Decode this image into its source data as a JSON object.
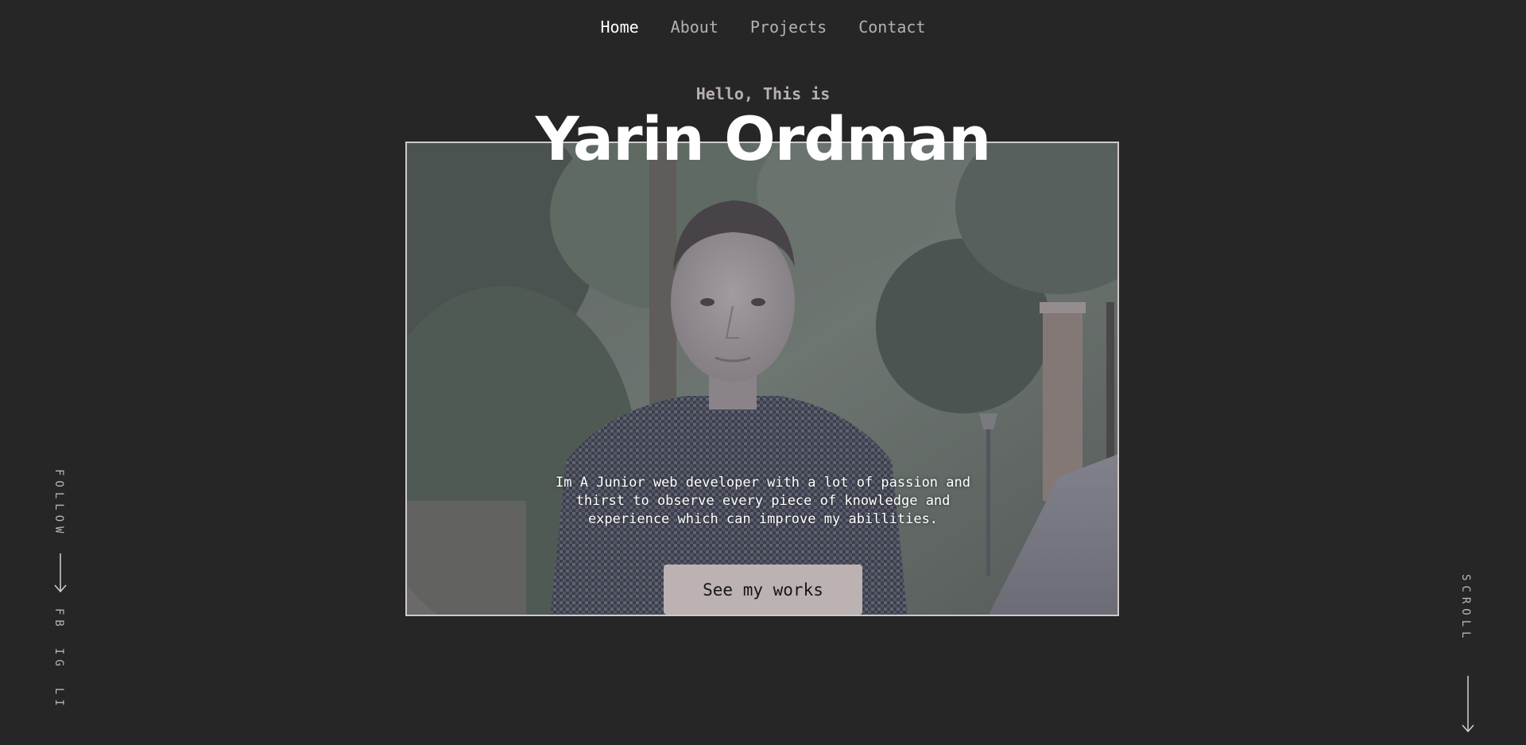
{
  "nav": {
    "items": [
      {
        "label": "Home",
        "active": true
      },
      {
        "label": "About",
        "active": false
      },
      {
        "label": "Projects",
        "active": false
      },
      {
        "label": "Contact",
        "active": false
      }
    ]
  },
  "hero": {
    "greeting": "Hello, This is",
    "name": "Yarin Ordman",
    "intro": "Im A Junior web developer with a lot of passion and thirst to observe every piece of knowledge and experience which can improve my abillities.",
    "cta_label": "See my works"
  },
  "follow": {
    "label": "FOLLOW",
    "links": [
      "FB",
      "IG",
      "LI"
    ]
  },
  "scroll": {
    "label": "SCROLL"
  },
  "colors": {
    "background": "#262626",
    "nav_inactive": "#b6b0b0",
    "button_bg": "#bdb2b2",
    "frame_border": "#cfcaca"
  },
  "icons": [
    "arrow-down-icon"
  ]
}
